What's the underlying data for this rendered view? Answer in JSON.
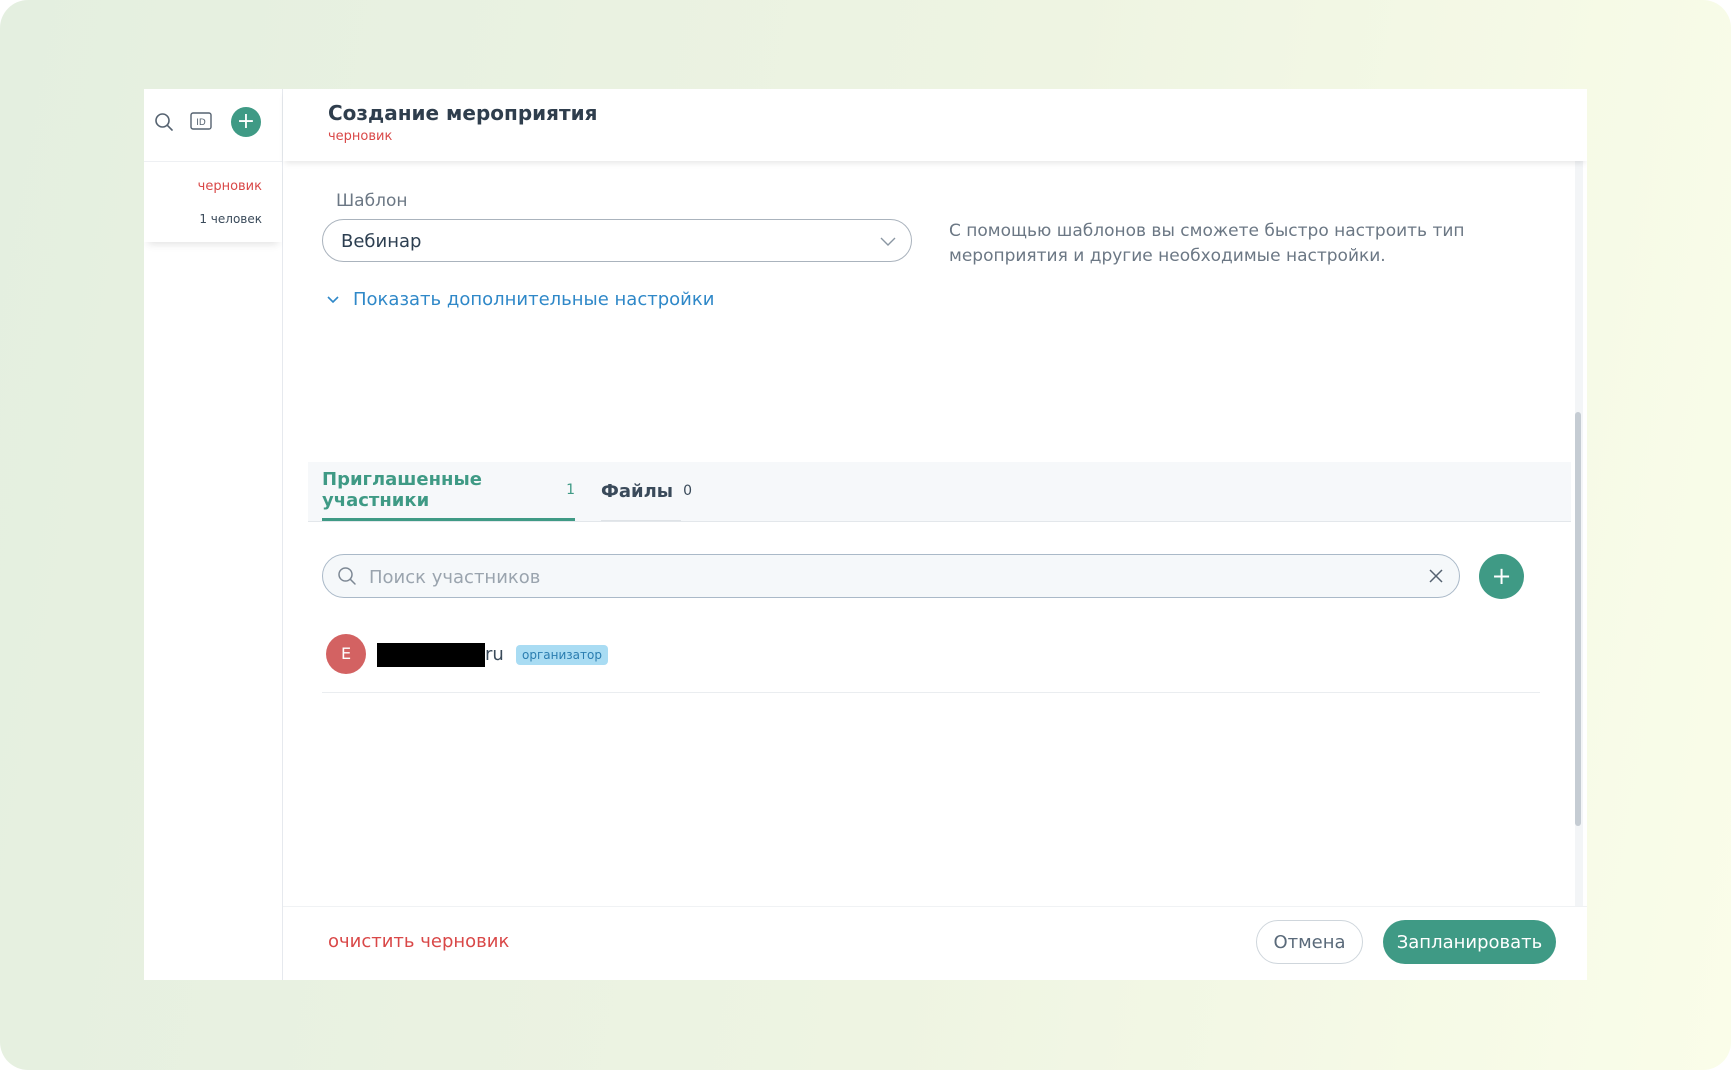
{
  "sidebar": {
    "status": "черновик",
    "people": "1 человек",
    "icons": {
      "search": "search-icon",
      "id": "id-card-icon",
      "add": "plus-icon"
    },
    "id_icon_text": "ID",
    "add_label": "+"
  },
  "header": {
    "title": "Создание мероприятия",
    "status": "черновик"
  },
  "template": {
    "label": "Шаблон",
    "value": "Вебинар",
    "hint": "С помощью шаблонов вы сможете быстро настроить тип мероприятия и другие необходимые настройки."
  },
  "advanced": {
    "label": "Показать дополнительные настройки"
  },
  "tabs": [
    {
      "label": "Приглашенные участники",
      "count": "1",
      "active": true
    },
    {
      "label": "Файлы",
      "count": "0",
      "active": false
    }
  ],
  "search": {
    "placeholder": "Поиск участников",
    "value": ""
  },
  "add_participant_label": "+",
  "participants": [
    {
      "initial": "E",
      "email_tail": "ru",
      "role": "организатор"
    }
  ],
  "footer": {
    "clear_draft": "очистить черновик",
    "cancel": "Отмена",
    "schedule": "Запланировать"
  },
  "colors": {
    "accent": "#3f9a85",
    "draft_red": "#d94848",
    "link_blue": "#2f88c8",
    "badge_bg": "#a9dcf3",
    "avatar": "#d36262"
  }
}
